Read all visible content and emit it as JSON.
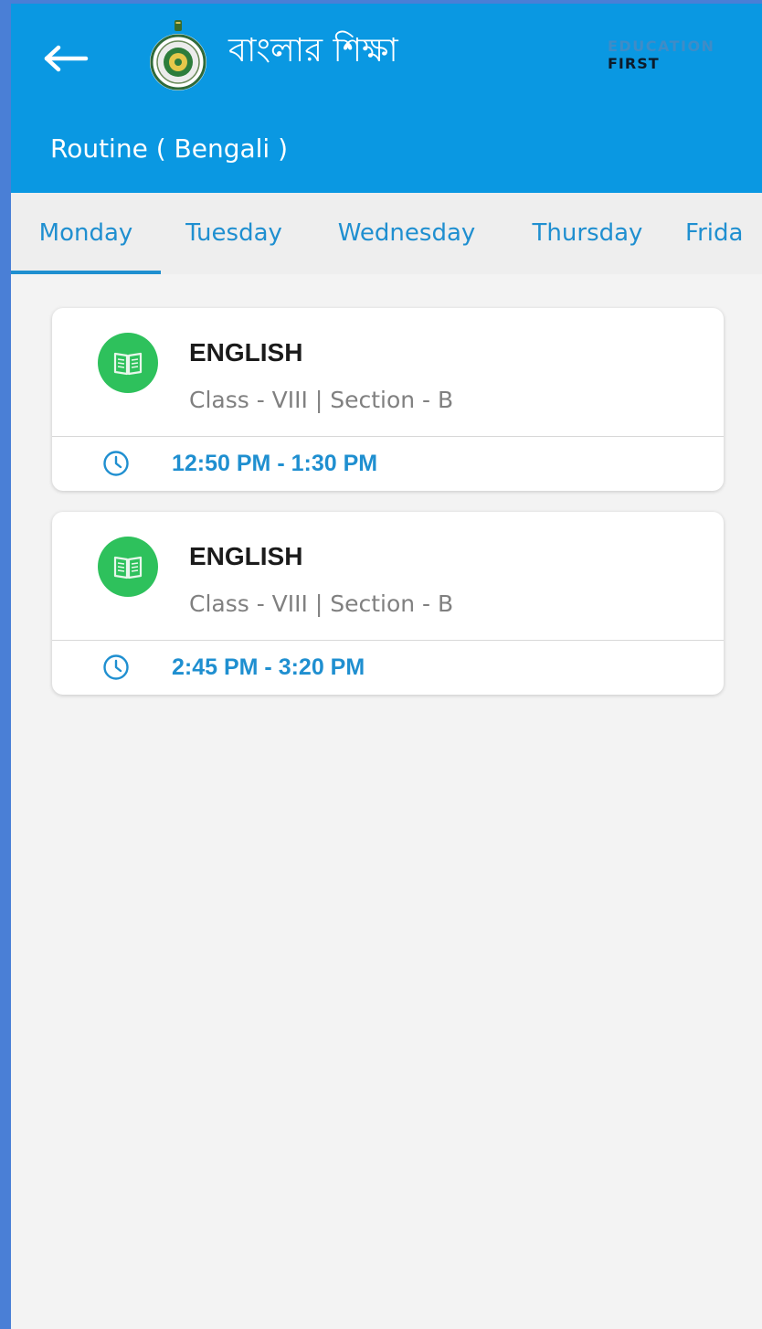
{
  "header": {
    "brand_title": "বাংলার শিক্ষা",
    "partner_top": "EDUCATION",
    "partner_bottom": "FIRST",
    "page_title": "Routine ( Bengali )"
  },
  "tabs": [
    {
      "label": "Monday",
      "selected": true
    },
    {
      "label": "Tuesday",
      "selected": false
    },
    {
      "label": "Wednesday",
      "selected": false
    },
    {
      "label": "Thursday",
      "selected": false
    },
    {
      "label": "Frida",
      "selected": false
    }
  ],
  "routine": [
    {
      "subject": "ENGLISH",
      "class_section": "Class - VIII | Section - B",
      "time": "12:50 PM - 1:30 PM",
      "icon": "book-icon"
    },
    {
      "subject": "ENGLISH",
      "class_section": "Class - VIII | Section - B",
      "time": "2:45 PM - 3:20 PM",
      "icon": "book-icon"
    }
  ],
  "colors": {
    "appbar": "#0a98e2",
    "tab_text": "#1f8fd0",
    "icon_badge": "#2ec15c",
    "time_text": "#1f8fd0"
  }
}
